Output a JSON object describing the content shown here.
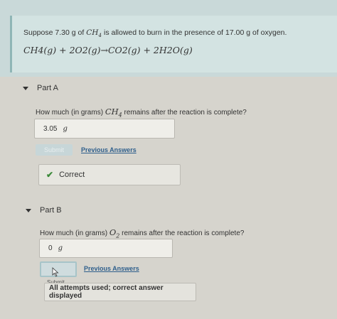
{
  "problem": {
    "intro_prefix": "Suppose 7.30",
    "mass1_unit": "g",
    "intro_of": "of",
    "compound": "CH",
    "compound_sub": "4",
    "intro_middle": "is allowed to burn in the presence of 17.00",
    "mass2_unit": "g",
    "intro_suffix": "of oxygen.",
    "equation": "CH4(g) + 2O2(g)→CO2(g) + 2H2O(g)"
  },
  "part_a": {
    "title": "Part A",
    "question_prefix": "How much (in grams)",
    "question_compound": "CH",
    "question_compound_sub": "4",
    "question_suffix": "remains after the reaction is complete?",
    "answer_value": "3.05",
    "answer_unit": "g",
    "submit_label": "Submit",
    "previous_answers_label": "Previous Answers",
    "feedback_label": "Correct"
  },
  "part_b": {
    "title": "Part B",
    "question_prefix": "How much (in grams)",
    "question_compound": "O",
    "question_compound_sub": "2",
    "question_suffix": "remains after the reaction is complete?",
    "answer_value": "0",
    "answer_unit": "g",
    "submit_label": "Submit",
    "previous_answers_label": "Previous Answers",
    "feedback_label": "All attempts used; correct answer displayed"
  },
  "icons": {
    "part_a_toggle": "caret-down-icon",
    "part_b_toggle": "caret-down-icon",
    "correct": "check-icon",
    "pointer": "mouse-pointer-icon"
  },
  "colors": {
    "correct_check": "#3c8a3a",
    "link": "#2f5f8c",
    "problem_bg": "#d3e3e2"
  }
}
